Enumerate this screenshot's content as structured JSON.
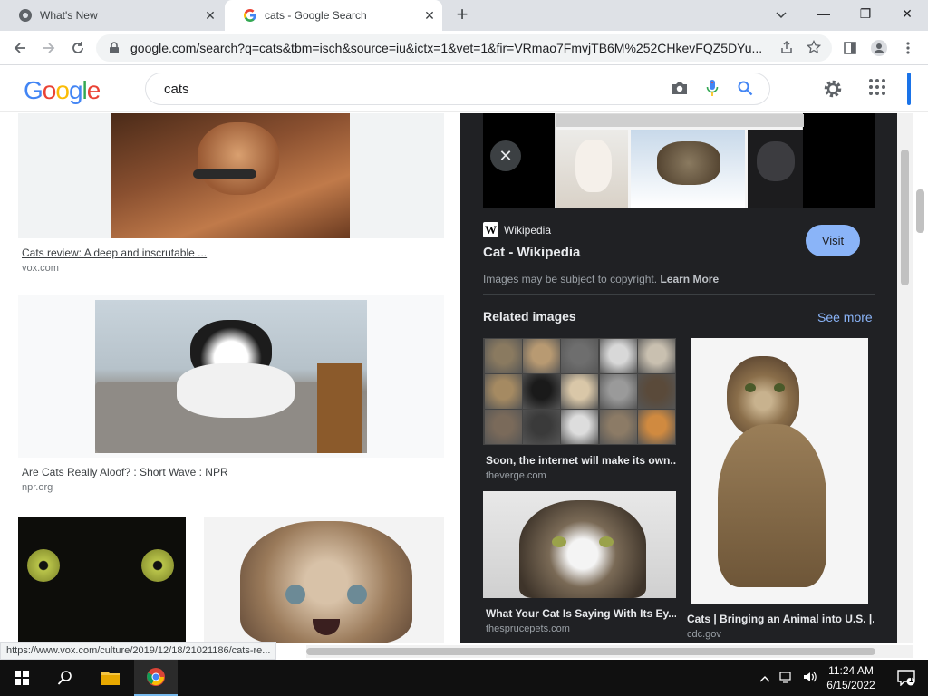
{
  "tabs": [
    {
      "title": "What's New"
    },
    {
      "title": "cats - Google Search"
    }
  ],
  "address": {
    "url": "google.com/search?q=cats&tbm=isch&source=iu&ictx=1&vet=1&fir=VRmao7FmvjTB6M%252CHkevFQZ5DYu..."
  },
  "google": {
    "logo": [
      "G",
      "o",
      "o",
      "g",
      "l",
      "e"
    ],
    "logo_colors": [
      "#4285f4",
      "#ea4335",
      "#fbbc05",
      "#4285f4",
      "#34a853",
      "#ea4335"
    ],
    "query": "cats"
  },
  "results": [
    {
      "title": "Cats review: A deep and inscrutable ...",
      "source": "vox.com"
    },
    {
      "title": "Are Cats Really Aloof? : Short Wave : NPR",
      "source": "npr.org"
    }
  ],
  "panel": {
    "site": "Wikipedia",
    "title": "Cat - Wikipedia",
    "visit_label": "Visit",
    "copyright": "Images may be subject to copyright.",
    "learn_more": "Learn More",
    "related_heading": "Related images",
    "see_more": "See more",
    "related": [
      {
        "caption": "Soon, the internet will make its own...",
        "source": "theverge.com"
      },
      {
        "caption": "What Your Cat Is Saying With Its Ey...",
        "source": "thesprucepets.com"
      },
      {
        "caption": "Cats | Bringing an Animal into U.S. |...",
        "source": "cdc.gov"
      }
    ]
  },
  "status_url": "https://www.vox.com/culture/2019/12/18/21021186/cats-re...",
  "clock": {
    "time": "11:24 AM",
    "date": "6/15/2022"
  },
  "notification_count": "1"
}
